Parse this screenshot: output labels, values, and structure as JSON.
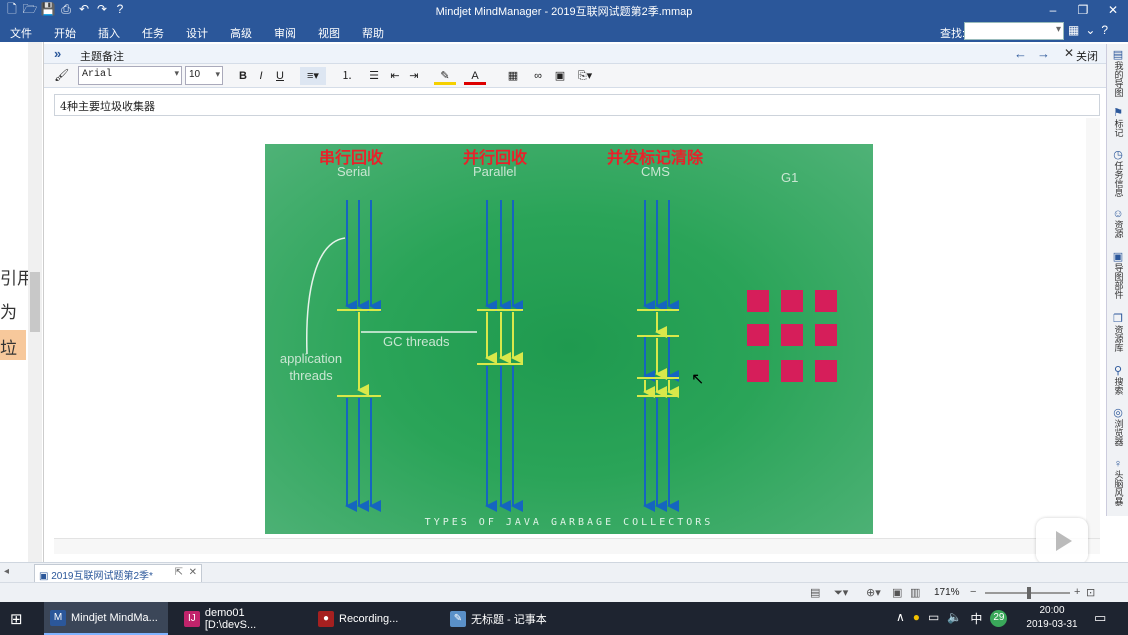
{
  "window": {
    "title": "Mindjet MindManager - 2019互联网试题第2季.mmap",
    "quick_access_icons": [
      "new-icon",
      "open-icon",
      "save-icon",
      "print-icon",
      "undo-icon",
      "redo-icon",
      "help-icon"
    ]
  },
  "menu": {
    "items": [
      "文件",
      "开始",
      "插入",
      "任务",
      "设计",
      "高级",
      "审阅",
      "视图",
      "帮助"
    ],
    "search_label": "查找:",
    "search_value": ""
  },
  "left_map": {
    "fragments": [
      "引用",
      "为",
      "垃"
    ]
  },
  "notes_panel": {
    "header_title": "主题备注",
    "close_label": "关闭",
    "font_family": "Arial",
    "font_size": "10",
    "toolbar_buttons": [
      "B",
      "I",
      "U"
    ],
    "note_title": "4种主要垃圾收集器"
  },
  "slide": {
    "red_labels": [
      "串行回收",
      "并行回收",
      "并发标记清除"
    ],
    "column_labels": [
      "Serial",
      "Parallel",
      "CMS",
      "G1"
    ],
    "annotations": {
      "application_threads": "application threads",
      "gc_threads": "GC threads"
    },
    "caption": "TYPES OF JAVA GARBAGE COLLECTORS",
    "colors": {
      "background": "#2aa458",
      "red_label": "#e8222a",
      "app_thread": "#1565c0",
      "gc_thread": "#d9e84a",
      "region": "#d61e5a"
    }
  },
  "side_panel": {
    "items": [
      "我的导图",
      "标记",
      "任务信息",
      "资源",
      "导图部件",
      "资源库",
      "搜索",
      "浏览器",
      "头脑风暴"
    ]
  },
  "doc_tab": {
    "label": "2019互联网试题第2季*"
  },
  "status": {
    "zoom": "171%"
  },
  "taskbar": {
    "tasks": [
      "Mindjet MindMa...",
      "demo01 [D:\\devS...",
      "Recording...",
      "无标题 - 记事本"
    ],
    "ime": "中",
    "badge": "29",
    "time": "20:00",
    "date": "2019-03-31"
  }
}
